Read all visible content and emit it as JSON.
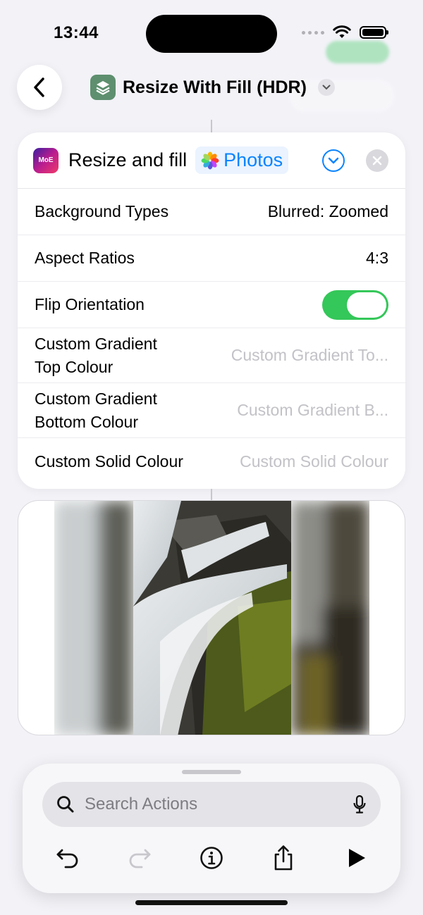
{
  "status_bar": {
    "time": "13:44"
  },
  "nav": {
    "title": "Resize With Fill (HDR)"
  },
  "action": {
    "title": "Resize and fill",
    "input_token": "Photos",
    "icon_text": "MoE",
    "params": [
      {
        "label": "Background Types",
        "value": "Blurred: Zoomed"
      },
      {
        "label": "Aspect Ratios",
        "value": "4:3"
      },
      {
        "label": "Flip Orientation",
        "toggle_on": true
      },
      {
        "label": "Custom Gradient Top Colour",
        "placeholder": "Custom Gradient To..."
      },
      {
        "label": "Custom Gradient Bottom Colour",
        "placeholder": "Custom Gradient B..."
      },
      {
        "label": "Custom Solid Colour",
        "placeholder": "Custom Solid Colour"
      }
    ]
  },
  "search": {
    "placeholder": "Search Actions"
  },
  "colors": {
    "accent": "#0a84ff",
    "toggle": "#34c759",
    "placeholder": "#c2c2c7"
  }
}
